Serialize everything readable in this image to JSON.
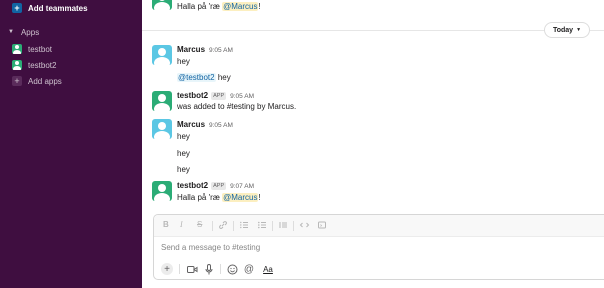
{
  "sidebar": {
    "add_teammates": "Add teammates",
    "apps_section": "Apps",
    "apps": [
      {
        "label": "testbot"
      },
      {
        "label": "testbot2"
      }
    ],
    "add_apps": "Add apps"
  },
  "top_message": {
    "text_before": "Halla på 'ræ ",
    "mention": "@Marcus",
    "text_after": "!"
  },
  "today_label": "Today",
  "messages": [
    {
      "name": "Marcus",
      "time": "9:05 AM",
      "lines": [
        "hey"
      ]
    },
    {
      "mention": "@testbot2",
      "text_after": " hey"
    },
    {
      "name": "testbot2",
      "app_tag": "APP",
      "time": "9:05 AM",
      "text": "was added to #testing by Marcus."
    },
    {
      "name": "Marcus",
      "time": "9:05 AM",
      "lines": [
        "hey",
        "hey",
        "hey"
      ]
    },
    {
      "name": "testbot2",
      "app_tag": "APP",
      "time": "9:07 AM",
      "text_before": "Halla på 'ræ ",
      "mention": "@Marcus",
      "text_after": "!"
    }
  ],
  "composer": {
    "placeholder": "Send a message to #testing",
    "format_icons": [
      "bold-icon",
      "italic-icon",
      "strikethrough-icon",
      "link-icon",
      "ordered-list-icon",
      "bulleted-list-icon",
      "blockquote-icon",
      "code-icon",
      "code-block-icon"
    ],
    "format_glyphs": {
      "bold": "B",
      "italic": "I",
      "strike": "S"
    },
    "aa_label": "Aa"
  },
  "colors": {
    "sidebar_bg": "#3f0e40",
    "mention_bg": "#fcefc0",
    "link_blue": "#1264a3",
    "bot_green": "#2bac76"
  }
}
